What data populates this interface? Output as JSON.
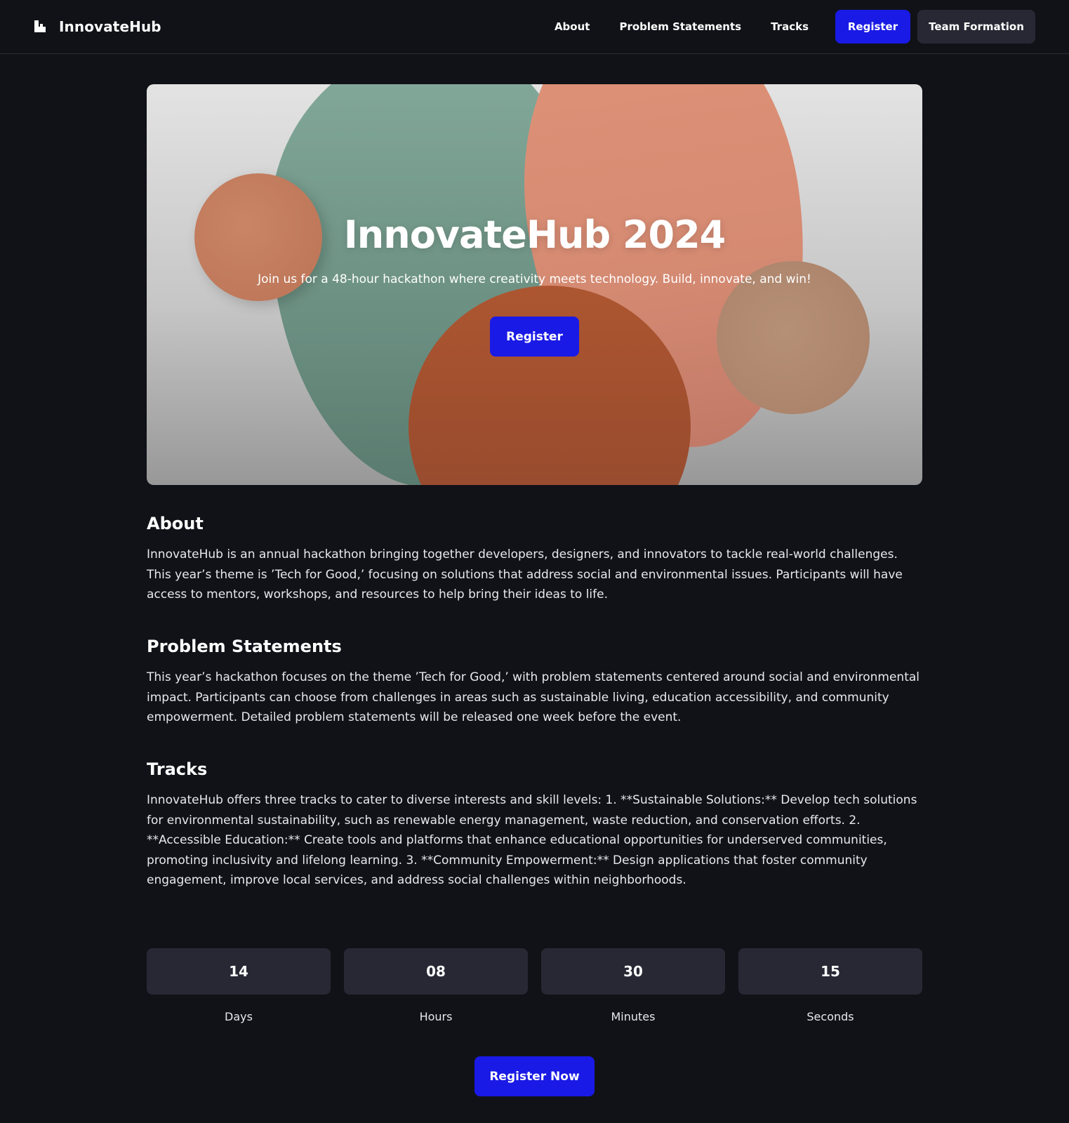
{
  "nav": {
    "brand": "InnovateHub",
    "links": [
      "About",
      "Problem Statements",
      "Tracks"
    ],
    "register_label": "Register",
    "team_label": "Team Formation"
  },
  "hero": {
    "title": "InnovateHub 2024",
    "subtitle": "Join us for a 48-hour hackathon where creativity meets technology. Build, innovate, and win!",
    "register_label": "Register"
  },
  "sections": {
    "about": {
      "title": "About",
      "body": "InnovateHub is an annual hackathon bringing together developers, designers, and innovators to tackle real-world challenges. This year’s theme is ’Tech for Good,’ focusing on solutions that address social and environmental issues. Participants will have access to mentors, workshops, and resources to help bring their ideas to life."
    },
    "problems": {
      "title": "Problem Statements",
      "body": "This year’s hackathon focuses on the theme ’Tech for Good,’ with problem statements centered around social and environmental impact. Participants can choose from challenges in areas such as sustainable living, education accessibility, and community empowerment. Detailed problem statements will be released one week before the event."
    },
    "tracks": {
      "title": "Tracks",
      "body": "InnovateHub offers three tracks to cater to diverse interests and skill levels: 1. **Sustainable Solutions:** Develop tech solutions for environmental sustainability, such as renewable energy management, waste reduction, and conservation efforts. 2. **Accessible Education:** Create tools and platforms that enhance educational opportunities for underserved communities, promoting inclusivity and lifelong learning. 3. **Community Empowerment:** Design applications that foster community engagement, improve local services, and address social challenges within neighborhoods."
    }
  },
  "countdown": [
    {
      "value": "14",
      "label": "Days"
    },
    {
      "value": "08",
      "label": "Hours"
    },
    {
      "value": "30",
      "label": "Minutes"
    },
    {
      "value": "15",
      "label": "Seconds"
    }
  ],
  "cta": {
    "register_now_label": "Register Now"
  },
  "colors": {
    "background": "#111218",
    "accent": "#1a1ae6",
    "card": "#272833"
  },
  "icons": {
    "brand_logo": "logo-icon"
  }
}
